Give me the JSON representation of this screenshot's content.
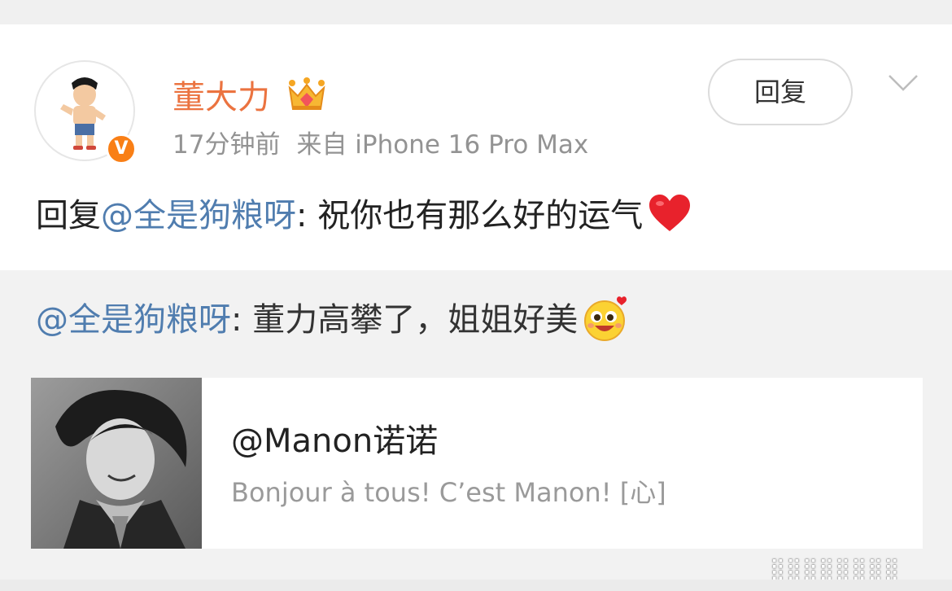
{
  "post": {
    "username": "董大力",
    "time": "17分钟前",
    "source": "来自 iPhone 16 Pro Max",
    "reply_button": "回复",
    "text": {
      "prefix": "回复",
      "mention": "@全是狗粮呀",
      "body": ": 祝你也有那么好的运气"
    },
    "verified_badge": "V",
    "icons": [
      "crown-vip-icon",
      "verified-v-icon",
      "chevron-down-icon",
      "red-heart-icon"
    ]
  },
  "repost": {
    "mention": "@全是狗粮呀",
    "body": ": 董力高攀了，姐姐好美",
    "emoji": "heart-eyes-emoji"
  },
  "card": {
    "title": "@Manon诺诺",
    "desc": "Bonjour à tous! C’est Manon! [心]"
  },
  "watermark": "⣿⣿⣿⣿⣿⣿⣿⣿",
  "colors": {
    "username": "#eb7340",
    "mention": "#507daf",
    "verified": "#f97f16",
    "meta": "#939393"
  }
}
